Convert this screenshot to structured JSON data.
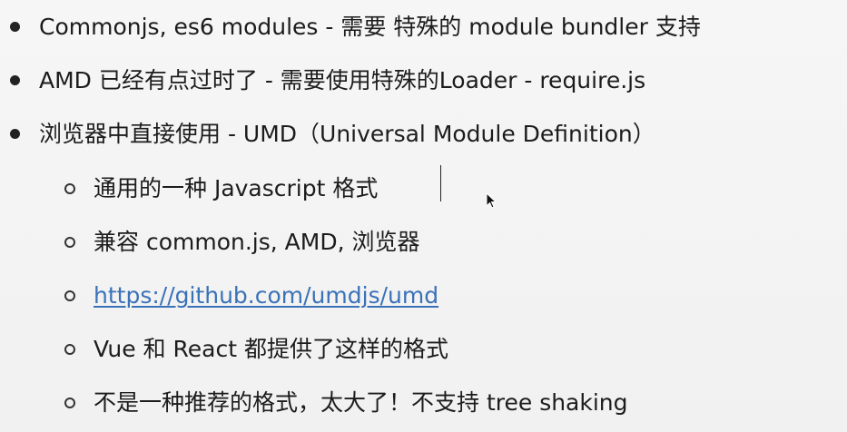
{
  "items": [
    {
      "text": "Commonjs, es6 modules - 需要 特殊的 module bundler 支持"
    },
    {
      "text": "AMD 已经有点过时了 - 需要使用特殊的Loader - require.js"
    },
    {
      "text": "浏览器中直接使用 - UMD（Universal Module Definition）"
    }
  ],
  "subitems": [
    {
      "text": "通用的一种 Javascript 格式"
    },
    {
      "text": "兼容 common.js, AMD, 浏览器"
    },
    {
      "text": "https://github.com/umdjs/umd",
      "is_link": true
    },
    {
      "text": "Vue 和 React 都提供了这样的格式"
    },
    {
      "text": "不是一种推荐的格式，太大了！不支持 tree shaking"
    }
  ],
  "colors": {
    "link": "#3a72b8",
    "text": "#1c1c1c",
    "background": "#f4f4f4"
  },
  "icons": {
    "bullet": "filled-circle-bullet",
    "sub_bullet": "hollow-circle-bullet",
    "pointer": "mouse-pointer-icon"
  }
}
